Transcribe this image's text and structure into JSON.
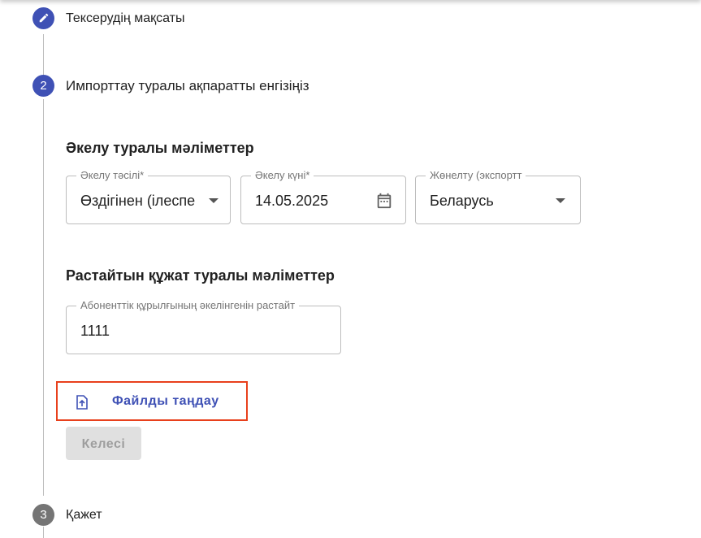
{
  "steps": [
    {
      "number": "",
      "label": "Тексерудің мақсаты",
      "state": "edited",
      "icon": "pencil-icon",
      "color": "#3f51b5"
    },
    {
      "number": "2",
      "label": "Импорттау туралы ақпаратты енгізіңіз",
      "state": "active",
      "color": "#3f51b5"
    },
    {
      "number": "3",
      "label": "Қажет",
      "state": "pending",
      "color": "#757575"
    }
  ],
  "import_section": {
    "title": "Әкелу туралы мәліметтер",
    "fields": [
      {
        "label": "Әкелу тәсілі*",
        "value": "Өздігінен (ілеспе",
        "type": "select"
      },
      {
        "label": "Әкелу күні*",
        "value": "14.05.2025",
        "type": "date"
      },
      {
        "label": "Жөнелту (экспортт",
        "value": "Беларусь",
        "type": "select"
      }
    ]
  },
  "document_section": {
    "title": "Растайтын құжат туралы мәліметтер",
    "field": {
      "label": "Абоненттік құрылғының әкелінгенін растайт",
      "value": "1111"
    }
  },
  "file_button": {
    "label": "Файлды таңдау",
    "icon": "file-upload-icon",
    "color": "#3f51b5",
    "highlight_color": "#e8401c"
  },
  "next_button": {
    "label": "Келесі",
    "enabled": false
  }
}
